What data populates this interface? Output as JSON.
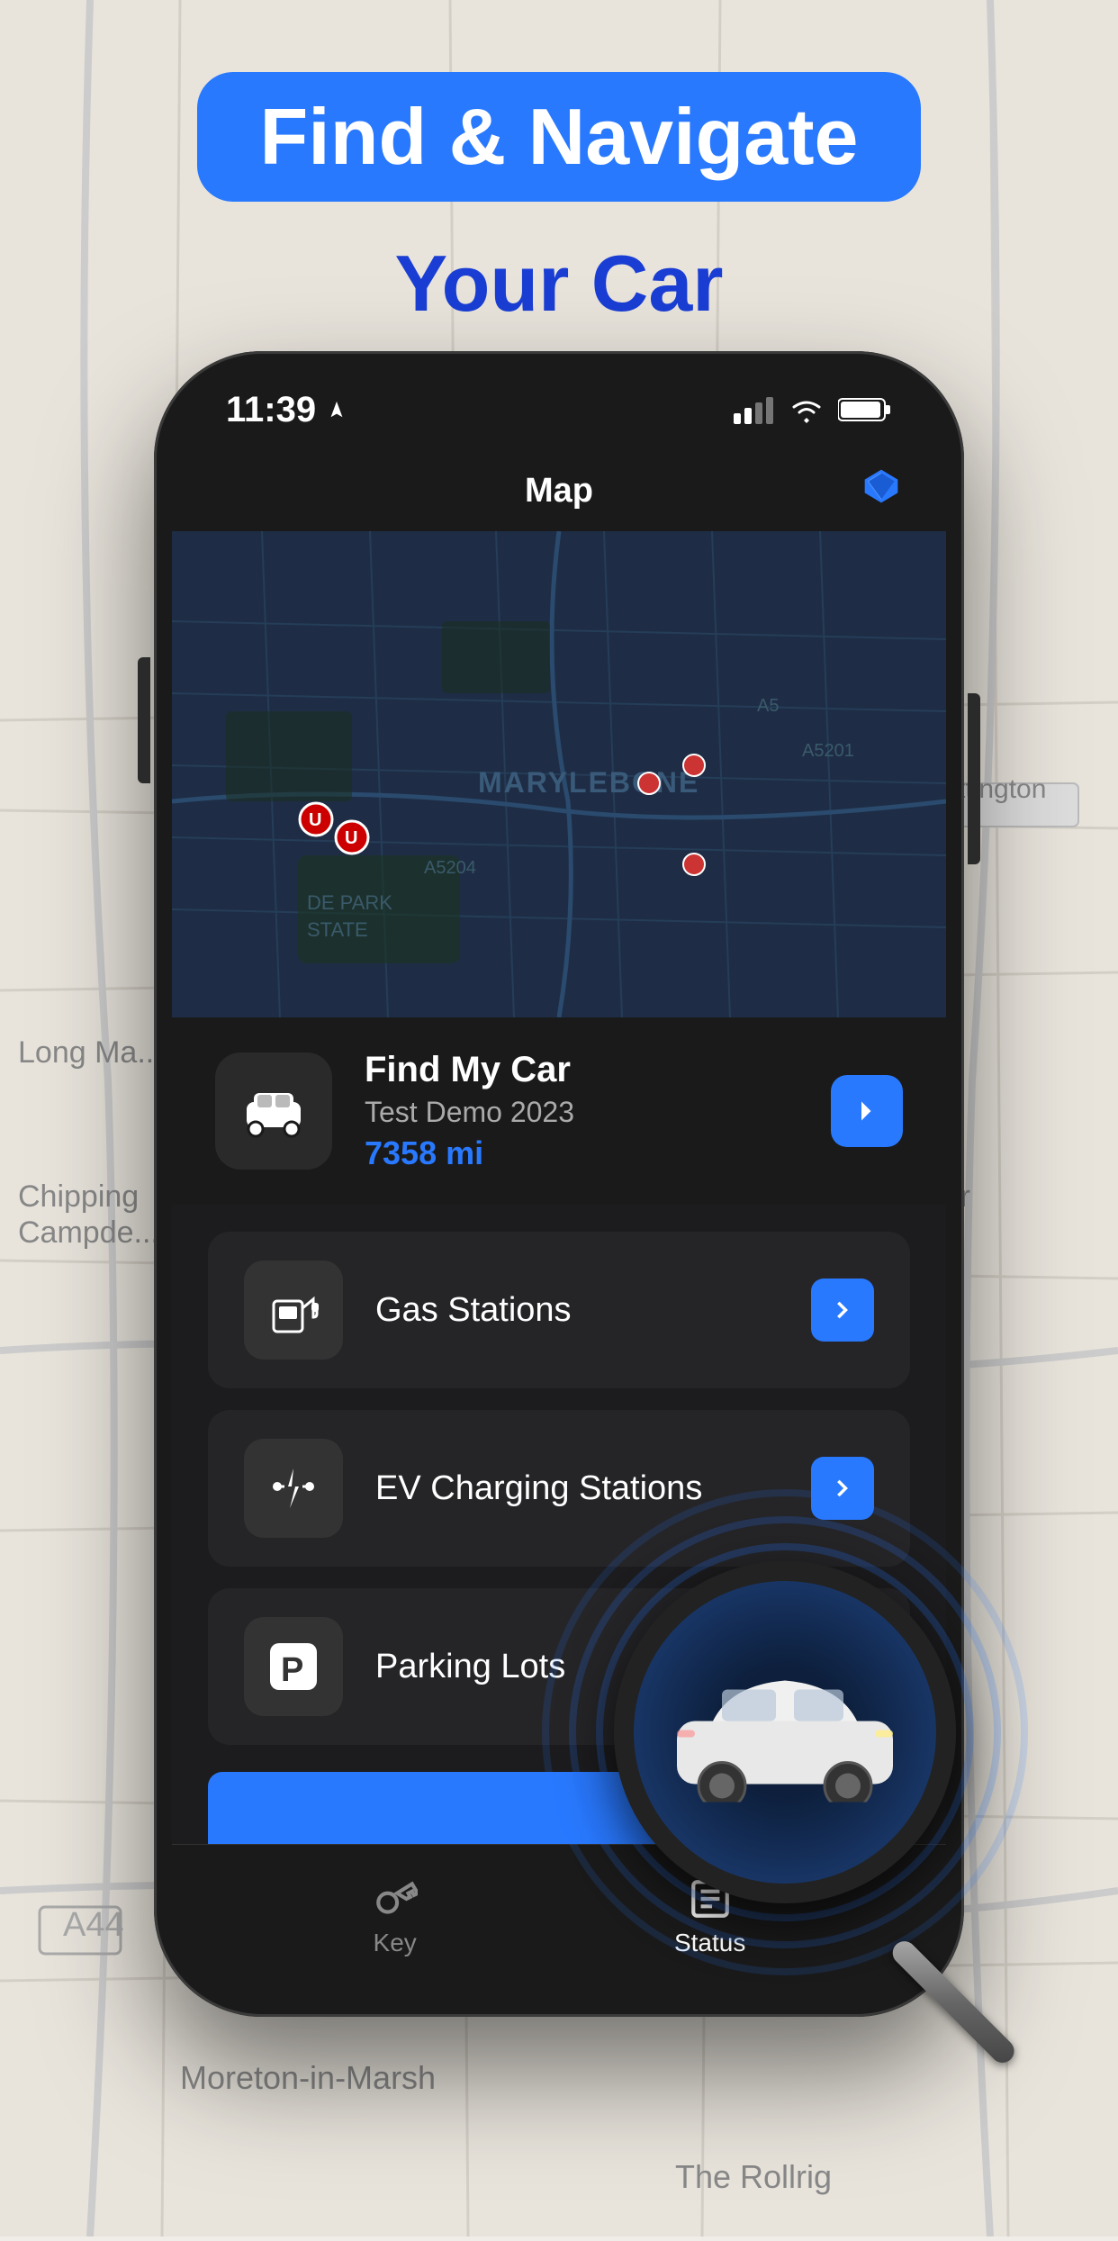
{
  "header": {
    "badge_text": "Find & Navigate",
    "subtitle": "Your Car"
  },
  "phone": {
    "status_time": "11:39",
    "nav_title": "Map",
    "map_area": "MARYLEBONE",
    "find_my_car": {
      "title": "Find My Car",
      "subtitle": "Test Demo 2023",
      "distance": "7358 mi"
    },
    "menu_items": [
      {
        "label": "Gas Stations",
        "icon": "gas-station-icon"
      },
      {
        "label": "EV Charging Stations",
        "icon": "ev-charging-icon"
      },
      {
        "label": "Parking Lots",
        "icon": "parking-icon"
      }
    ],
    "tabs": [
      {
        "label": "Key",
        "active": false
      },
      {
        "label": "Status",
        "active": true
      }
    ]
  }
}
